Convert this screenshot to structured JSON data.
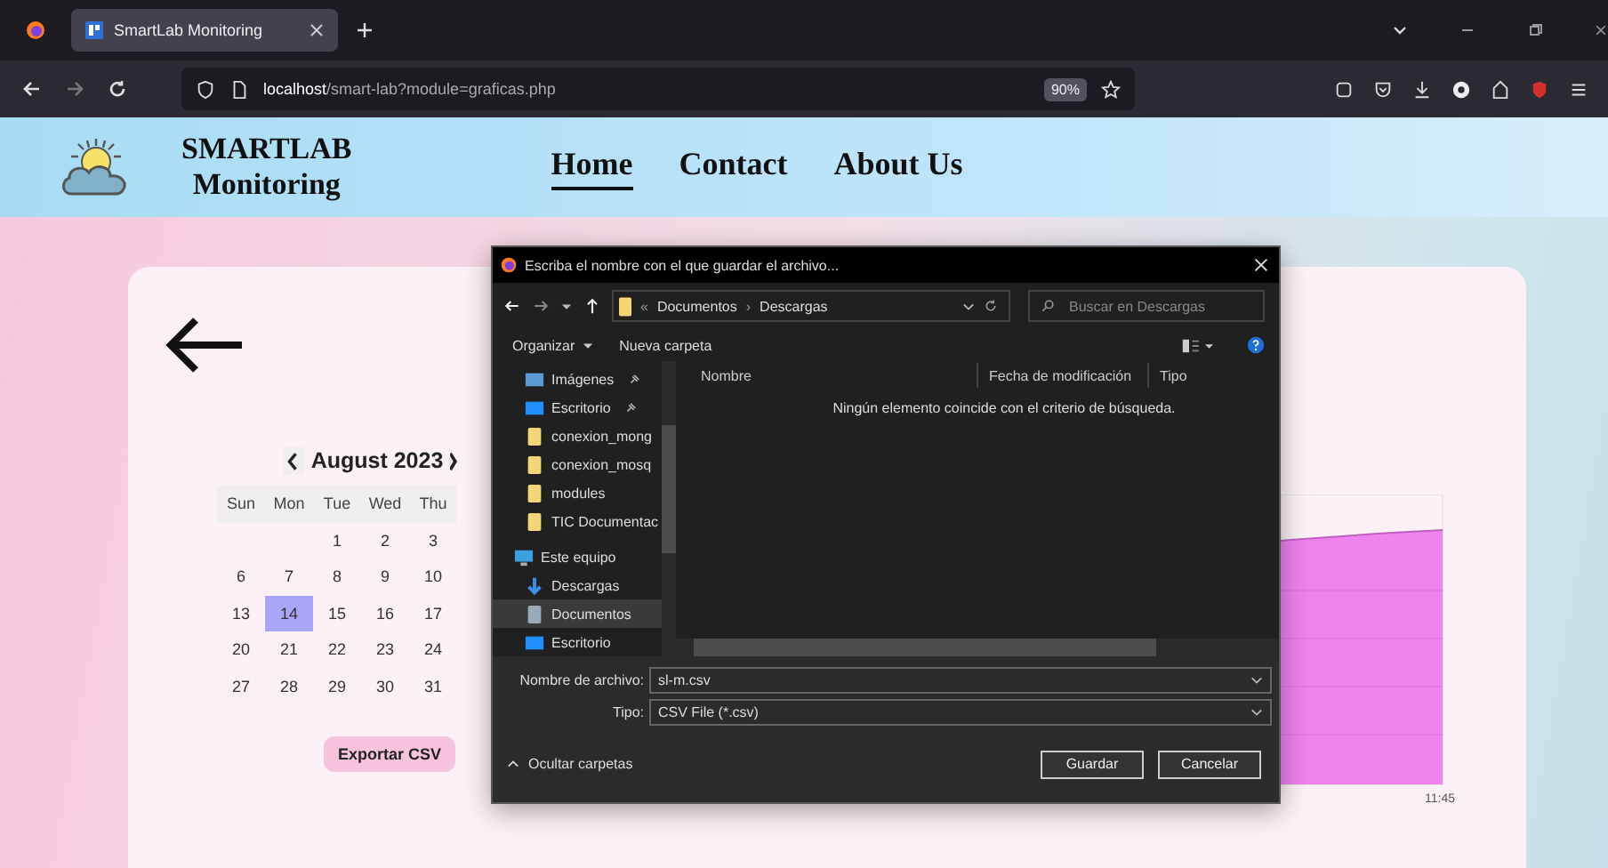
{
  "browser": {
    "tab": {
      "title": "SmartLab Monitoring",
      "selected": true
    },
    "url": {
      "host": "localhost",
      "path": "/smart-lab?module=graficas.php"
    },
    "zoom": "90%"
  },
  "site": {
    "title_lines": [
      "SMARTLAB",
      "Monitoring"
    ],
    "nav": [
      {
        "label": "Home",
        "selected": true
      },
      {
        "label": "Contact",
        "selected": false
      },
      {
        "label": "About Us",
        "selected": false
      }
    ]
  },
  "calendar": {
    "month": "August 2023",
    "weekdays": [
      "Sun",
      "Mon",
      "Tue",
      "Wed",
      "Thu"
    ],
    "weeks": [
      [
        {
          "kind": "empty"
        },
        {
          "kind": "empty"
        },
        {
          "kind": "day",
          "day": "1",
          "selected": false
        },
        {
          "kind": "day",
          "day": "2",
          "selected": false
        },
        {
          "kind": "day",
          "day": "3",
          "selected": false
        }
      ],
      [
        {
          "kind": "day",
          "day": "6",
          "selected": false
        },
        {
          "kind": "day",
          "day": "7",
          "selected": false
        },
        {
          "kind": "day",
          "day": "8",
          "selected": false
        },
        {
          "kind": "day",
          "day": "9",
          "selected": false
        },
        {
          "kind": "day",
          "day": "10",
          "selected": false
        }
      ],
      [
        {
          "kind": "day",
          "day": "13",
          "selected": false
        },
        {
          "kind": "day",
          "day": "14",
          "selected": true
        },
        {
          "kind": "day",
          "day": "15",
          "selected": false
        },
        {
          "kind": "day",
          "day": "16",
          "selected": false
        },
        {
          "kind": "day",
          "day": "17",
          "selected": false
        }
      ],
      [
        {
          "kind": "day",
          "day": "20",
          "selected": false
        },
        {
          "kind": "day",
          "day": "21",
          "selected": false
        },
        {
          "kind": "day",
          "day": "22",
          "selected": false
        },
        {
          "kind": "day",
          "day": "23",
          "selected": false
        },
        {
          "kind": "day",
          "day": "24",
          "selected": false
        }
      ],
      [
        {
          "kind": "day",
          "day": "27",
          "selected": false
        },
        {
          "kind": "day",
          "day": "28",
          "selected": false
        },
        {
          "kind": "day",
          "day": "29",
          "selected": false
        },
        {
          "kind": "day",
          "day": "30",
          "selected": false
        },
        {
          "kind": "day",
          "day": "31",
          "selected": false
        }
      ]
    ]
  },
  "export_button": "Exportar CSV",
  "chart": {
    "x_label": "11:45"
  },
  "dialog": {
    "title": "Escriba el nombre con el que guardar el archivo...",
    "breadcrumb": {
      "prefix": "«",
      "parts": [
        "Documentos",
        "Descargas"
      ],
      "separator": "›"
    },
    "search": {
      "placeholder": "Buscar en Descargas"
    },
    "toolbar": [
      "Organizar",
      "Nueva carpeta"
    ],
    "tree": [
      {
        "label": "Imágenes",
        "kind": "pictures",
        "pinned": true,
        "selected": false
      },
      {
        "label": "Escritorio",
        "kind": "desktop",
        "pinned": true,
        "selected": false
      },
      {
        "label": "conexion_mong",
        "kind": "folder",
        "pinned": false,
        "selected": false
      },
      {
        "label": "conexion_mosq",
        "kind": "folder",
        "pinned": false,
        "selected": false
      },
      {
        "label": "modules",
        "kind": "folder",
        "pinned": false,
        "selected": false
      },
      {
        "label": "TIC Documentac",
        "kind": "folder",
        "pinned": false,
        "selected": false
      },
      {
        "label": "Este equipo",
        "kind": "pc",
        "pinned": false,
        "selected": false,
        "children": [
          {
            "label": "Descargas",
            "kind": "download",
            "pinned": false,
            "selected": false
          },
          {
            "label": "Documentos",
            "kind": "document",
            "pinned": false,
            "selected": true
          },
          {
            "label": "Escritorio",
            "kind": "desktop",
            "pinned": false,
            "selected": false
          }
        ]
      }
    ],
    "columns": [
      "Nombre",
      "Fecha de modificación",
      "Tipo"
    ],
    "empty_message": "Ningún elemento coincide con el criterio de búsqueda.",
    "fields": [
      {
        "label": "Nombre de archivo:",
        "value": "sl-m.csv"
      },
      {
        "label": "Tipo:",
        "value": "CSV File (*.csv)"
      }
    ],
    "hide_folders": "Ocultar carpetas",
    "buttons": [
      "Guardar",
      "Cancelar"
    ]
  }
}
